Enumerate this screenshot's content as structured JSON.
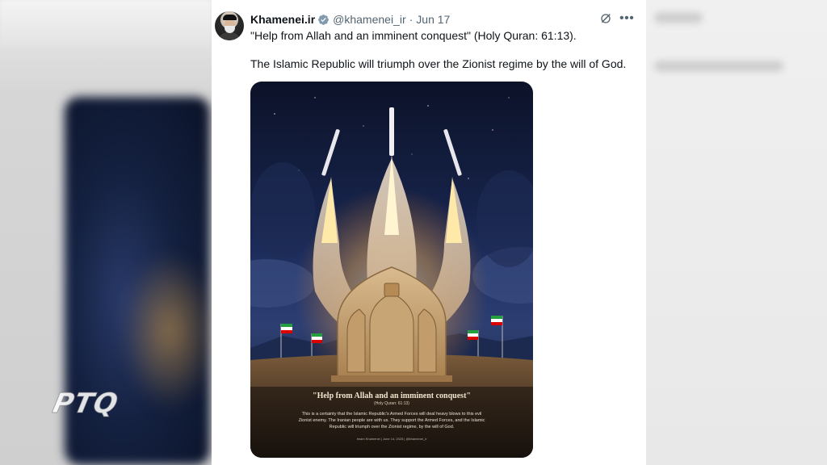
{
  "tweet": {
    "display_name": "Khamenei.ir",
    "handle": "@khamenei_ir",
    "separator": "·",
    "date": "Jun 17",
    "text_line1": "\"Help from Allah and an imminent conquest\" (Holy Quran: 61:13).",
    "text_line2": "The Islamic Republic will triumph over the Zionist regime by the will of God."
  },
  "poster": {
    "title": "\"Help from Allah and an imminent conquest\"",
    "subtitle": "(Holy Quran: 61:13)",
    "body": "This is a certainty that the Islamic Republic's Armed Forces will deal heavy blows to this evil Zionist enemy. The Iranian people are with us. They support the Armed Forces, and the Islamic Republic will triumph over the Zionist regime, by the will of God.",
    "footer": "Imam Khamenei | June 14, 2025 | @khamenei_ir"
  },
  "watermark": {
    "text": "PTQ"
  },
  "icons": {
    "verified": "verified-badge-icon",
    "grok": "grok-icon",
    "more": "more-icon"
  },
  "colors": {
    "verified": "#829aab",
    "text": "#0f1419",
    "secondary": "#536471"
  }
}
